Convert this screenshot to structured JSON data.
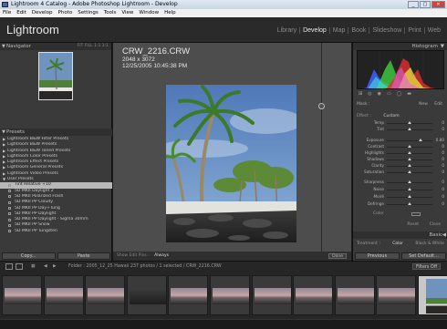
{
  "window": {
    "title": "Lightroom 4 Catalog - Adobe Photoshop Lightroom - Develop",
    "controls": [
      "_",
      "□",
      "✕"
    ]
  },
  "menu": [
    "File",
    "Edit",
    "Develop",
    "Photo",
    "Settings",
    "Tools",
    "View",
    "Window",
    "Help"
  ],
  "app": {
    "brand": "Lightroom"
  },
  "modules": [
    {
      "label": "Library",
      "active": false
    },
    {
      "label": "Develop",
      "active": true
    },
    {
      "label": "Map",
      "active": false
    },
    {
      "label": "Book",
      "active": false
    },
    {
      "label": "Slideshow",
      "active": false
    },
    {
      "label": "Print",
      "active": false
    },
    {
      "label": "Web",
      "active": false
    }
  ],
  "navigator": {
    "title": "Navigator",
    "zooms": "FIT   FILL   1:1   3:1"
  },
  "presets": {
    "title": "Presets",
    "folders": [
      "Lightroom B&W Filter Presets",
      "Lightroom B&W Presets",
      "Lightroom B&W Toned Presets",
      "Lightroom Color Presets",
      "Lightroom Effect Presets",
      "Lightroom General Presets",
      "Lightroom Video Presets",
      "User Presets"
    ],
    "user_items": [
      "Tint Relative +10",
      "5D MKII Daylight 2",
      "5D MKII Polarized Flash",
      "5D MKII PP Cloudy",
      "5D MKII PP Day+Tung",
      "5D MKII PP Daylight",
      "5D MKII PP Daylight - Sigma 30mm",
      "5D MKII PP Snow",
      "5D MKII PP Tungsten"
    ],
    "selected_index": 0
  },
  "left_buttons": {
    "copy": "Copy...",
    "paste": "Paste"
  },
  "photo_info": {
    "filename": "CRW_2216.CRW",
    "dimensions": "2048 x 3072",
    "datetime": "12/25/2005 10:45:38 PM"
  },
  "toolbar": {
    "show_edit_pins": "Show Edit Pins :",
    "pins_value": "Always",
    "done": "Done"
  },
  "right": {
    "histogram": "Histogram",
    "mask": {
      "label": "Mask :",
      "new": "New",
      "edit": "Edit"
    },
    "effect": {
      "label": "Effect :",
      "value": "Custom"
    },
    "sliders_top": [
      {
        "label": "Temp",
        "pos": 0.5,
        "value": "0"
      },
      {
        "label": "Tint",
        "pos": 0.5,
        "value": "0"
      }
    ],
    "sliders_mid": [
      {
        "label": "Exposure",
        "pos": 0.73,
        "value": "0.80"
      },
      {
        "label": "Contrast",
        "pos": 0.5,
        "value": "0"
      },
      {
        "label": "Highlights",
        "pos": 0.5,
        "value": "0"
      },
      {
        "label": "Shadows",
        "pos": 0.5,
        "value": "0"
      },
      {
        "label": "Clarity",
        "pos": 0.5,
        "value": "0"
      },
      {
        "label": "Saturation",
        "pos": 0.5,
        "value": "0"
      }
    ],
    "sliders_low": [
      {
        "label": "Sharpness",
        "pos": 0.5,
        "value": "0"
      },
      {
        "label": "Noise",
        "pos": 0.5,
        "value": "0"
      },
      {
        "label": "Moiré",
        "pos": 0.5,
        "value": "0"
      },
      {
        "label": "Defringe",
        "pos": 0.5,
        "value": "0"
      }
    ],
    "color": {
      "label": "Color"
    },
    "reset_row": {
      "reset": "Reset",
      "close": "Close"
    },
    "basic": "Basic",
    "treatment": {
      "label": "Treatment :",
      "color": "Color",
      "bw": "Black & White"
    },
    "previous": "Previous",
    "set_default": "Set Default..."
  },
  "filmbar": {
    "monitor1": "1",
    "monitor2": "2",
    "path": "Folder : 2005_12_25 Hawaii    237 photos / 1 selected / CRW_2216.CRW",
    "filter": "Filters Off"
  },
  "filmstrip": {
    "cells": [
      {
        "kind": "sunset"
      },
      {
        "kind": "sunset"
      },
      {
        "kind": "sunset"
      },
      {
        "kind": "dark"
      },
      {
        "kind": "sunset"
      },
      {
        "kind": "sunset"
      },
      {
        "kind": "sunset"
      },
      {
        "kind": "sunset"
      },
      {
        "kind": "sunset"
      },
      {
        "kind": "sunset"
      },
      {
        "kind": "palm",
        "selected": true
      }
    ]
  },
  "colors": {
    "panel": "#3a3a3a",
    "accent": "#e8e8e8",
    "histo_red": "#e03030",
    "histo_green": "#40d040",
    "histo_blue": "#4060ff"
  }
}
